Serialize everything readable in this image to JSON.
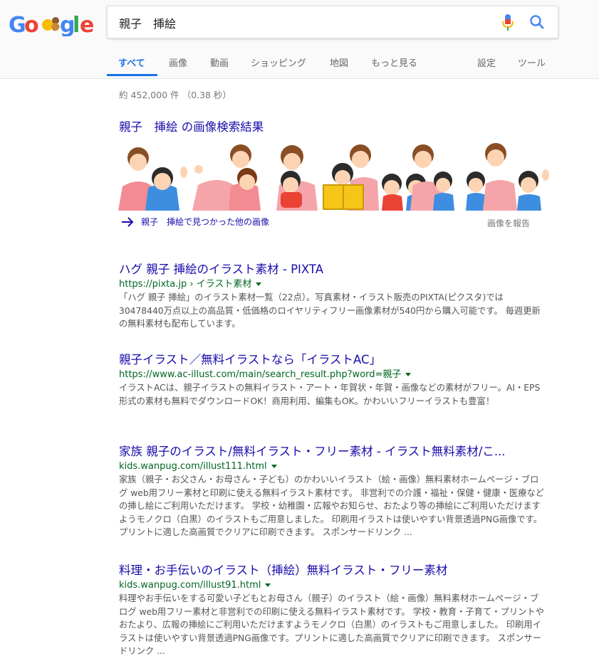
{
  "search": {
    "query": "親子　挿絵",
    "logo_alt": "Google"
  },
  "tabs": [
    {
      "label": "すべて"
    },
    {
      "label": "画像"
    },
    {
      "label": "動画"
    },
    {
      "label": "ショッピング"
    },
    {
      "label": "地図"
    },
    {
      "label": "もっと見る"
    },
    {
      "label": "設定"
    },
    {
      "label": "ツール"
    }
  ],
  "stats": "約 452,000 件 （0.38 秒）",
  "images": {
    "title": "親子　挿絵 の画像検索結果",
    "more": "親子　挿絵で見つかった他の画像",
    "report": "画像を報告"
  },
  "results": [
    {
      "title": "ハグ 親子 挿絵のイラスト素材 - PIXTA",
      "url": "https://pixta.jp › イラスト素材",
      "snippet": "「ハグ 親子 挿絵」のイラスト素材一覧（22点）。写真素材・イラスト販売のPIXTA(ピクスタ)では30478440万点以上の高品質・低価格のロイヤリティフリー画像素材が540円から購入可能です。 毎週更新の無料素材も配布しています。"
    },
    {
      "title": "親子イラスト／無料イラストなら「イラストAC」",
      "url": "https://www.ac-illust.com/main/search_result.php?word=親子",
      "snippet": "イラストACは、親子イラストの無料イラスト・アート・年賀状・年賀・画像などの素材がフリー。AI・EPS形式の素材も無料でダウンロードOK！商用利用、編集もOK。かわいいフリーイラストも豊富！"
    },
    {
      "title": "家族 親子のイラスト/無料イラスト・フリー素材 - イラスト無料素材/こ...",
      "url": "kids.wanpug.com/illust111.html",
      "snippet": "家族（親子・お父さん・お母さん・子ども）のかわいいイラスト（絵・画像）無料素材ホームページ・ブログ web用フリー素材と印刷に使える無料イラスト素材です。 非営利での介護・福祉・保健・健康・医療などの挿し絵にご利用いただけます。 学校・幼稚園・広報やお知らせ、おたより等の挿絵にご利用いただけますようモノクロ（白黒）のイラストもご用意しました。 印刷用イラストは使いやすい背景透過PNG画像です。プリントに適した高画質でクリアに印刷できます。 スポンサードリンク ..."
    },
    {
      "title": "料理・お手伝いのイラスト（挿絵）無料イラスト・フリー素材",
      "url": "kids.wanpug.com/illust91.html",
      "snippet": "料理やお手伝いをする可愛い子どもとお母さん（親子）のイラスト（絵・画像）無料素材ホームページ・ブログ web用フリー素材と非営利での印刷に使える無料イラスト素材です。 学校・教育・子育て・プリントやおたより、広報の挿絵にご利用いただけますようモノクロ（白黒）のイラストもご用意しました。 印刷用イラストは使いやすい背景透過PNG画像です。プリントに適した高画質でクリアに印刷できます。 スポンサードリンク ..."
    }
  ],
  "colors": {
    "link": "#1a0dab",
    "url": "#006621",
    "active_tab": "#1a73e8",
    "snippet": "#545454"
  }
}
